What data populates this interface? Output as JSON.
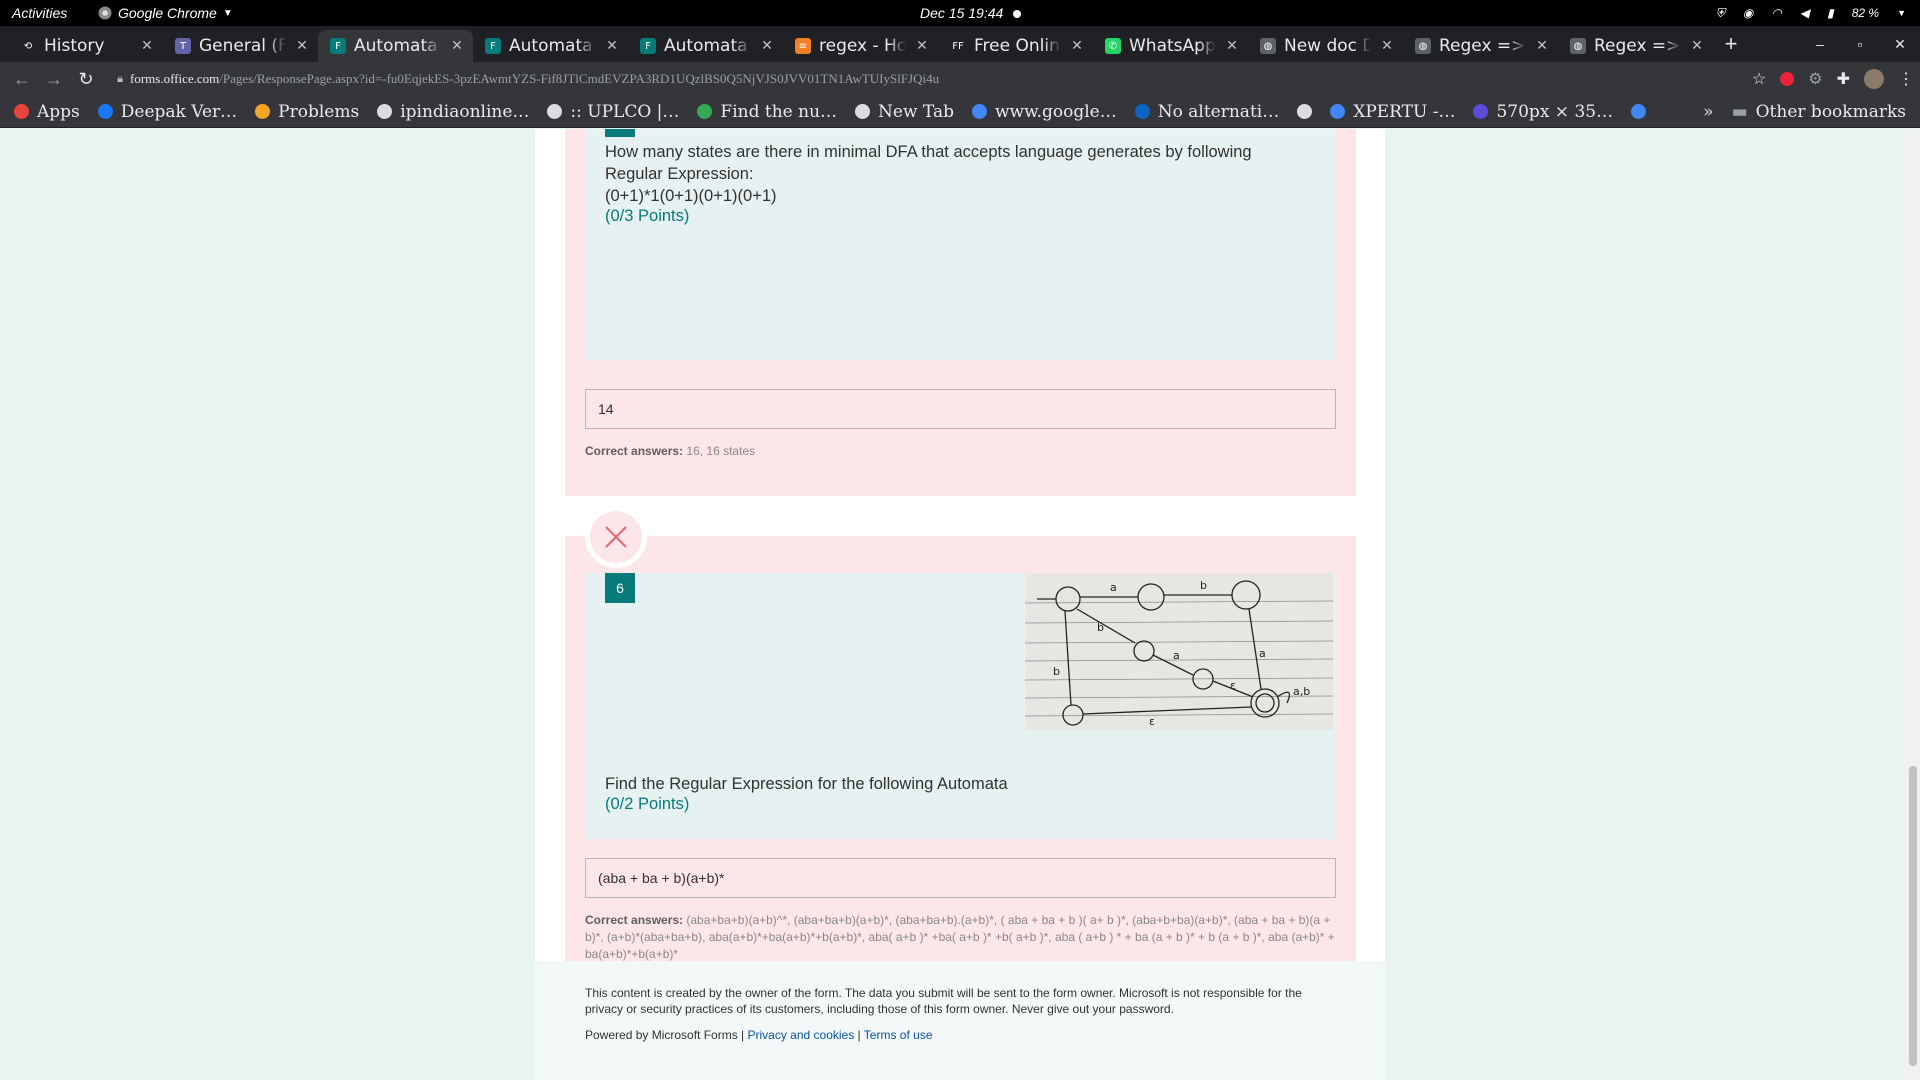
{
  "system": {
    "activities": "Activities",
    "app_name": "Google Chrome",
    "clock": "Dec 15  19:44",
    "battery": "82 %"
  },
  "tabs": [
    {
      "label": "History",
      "icon": "history-icon",
      "active": false
    },
    {
      "label": "General (Fl",
      "icon": "teams-icon",
      "active": false
    },
    {
      "label": "Automata Q",
      "icon": "forms-icon",
      "active": true
    },
    {
      "label": "Automata Q",
      "icon": "forms-icon",
      "active": false
    },
    {
      "label": "Automata Q",
      "icon": "forms-icon",
      "active": false
    },
    {
      "label": "regex - How",
      "icon": "stackoverflow-icon",
      "active": false
    },
    {
      "label": "Free Online",
      "icon": "ff-icon",
      "active": false
    },
    {
      "label": "WhatsApp",
      "icon": "whatsapp-icon",
      "active": false
    },
    {
      "label": "New doc D",
      "icon": "globe-icon",
      "active": false
    },
    {
      "label": "Regex => N",
      "icon": "globe-icon",
      "active": false
    },
    {
      "label": "Regex => N",
      "icon": "globe-icon",
      "active": false
    }
  ],
  "address_bar": {
    "domain": "forms.office.com",
    "path": "/Pages/ResponsePage.aspx?id=-fu0EqjekES-3pzEAwmtYZS-Fif8JTlCmdEVZPA3RD1UQzlBS0Q5NjVJS0JVV01TN1AwTUIySlFJQi4u"
  },
  "bookmarks": [
    {
      "label": "Apps",
      "color": "#e8453c"
    },
    {
      "label": "Deepak Ver…",
      "color": "#1877f2"
    },
    {
      "label": "Problems",
      "color": "#f5a623"
    },
    {
      "label": "ipindiaonline…",
      "color": "#dadce0"
    },
    {
      "label": ":: UPLCO |…",
      "color": "#dadce0"
    },
    {
      "label": "Find the nu…",
      "color": "#34a853"
    },
    {
      "label": "New Tab",
      "color": "#dadce0"
    },
    {
      "label": "www.google…",
      "color": "#4285f4"
    },
    {
      "label": "No alternati…",
      "color": "#0a66c2"
    },
    {
      "label": "",
      "color": "#dadce0"
    },
    {
      "label": "XPERTU -…",
      "color": "#4285f4"
    },
    {
      "label": "570px × 35…",
      "color": "#5b4cdb"
    },
    {
      "label": "",
      "color": "#4285f4"
    }
  ],
  "other_bookmarks": "Other bookmarks",
  "question5": {
    "text_line1": "How many states are there in minimal DFA that accepts language generates by following",
    "text_line2": "Regular Expression:",
    "text_line3": "(0+1)*1(0+1)(0+1)(0+1)",
    "points": "(0/3 Points)",
    "answer": "14",
    "correct_label": "Correct answers:",
    "correct_values": "16, 16 states"
  },
  "question6": {
    "number": "6",
    "text": "Find the Regular Expression for the following Automata",
    "points": "(0/2 Points)",
    "answer": "(aba + ba + b)(a+b)*",
    "correct_label": "Correct answers:",
    "correct_values": "(aba+ba+b)(a+b)^*, (aba+ba+b)(a+b)*, (aba+ba+b).(a+b)*, ( aba + ba + b )( a+ b )*, (aba+b+ba)(a+b)*, (aba + ba + b)(a + b)*, (a+b)*(aba+ba+b), aba(a+b)*+ba(a+b)*+b(a+b)*, aba( a+b )* +ba( a+b )* +b( a+b )*, aba ( a+b ) * + ba (a + b )* + b (a + b )*, aba (a+b)* + ba(a+b)*+b(a+b)*"
  },
  "footer": {
    "disclaimer": "This content is created by the owner of the form. The data you submit will be sent to the form owner. Microsoft is not responsible for the privacy or security practices of its customers, including those of this form owner. Never give out your password.",
    "powered_by": "Powered by Microsoft Forms | ",
    "privacy_link": "Privacy and cookies",
    "separator": " | ",
    "terms_link": "Terms of use"
  },
  "colors": {
    "teal": "#077a7a",
    "pink": "#fde6e8",
    "incorrect_x": "#e66a75"
  }
}
